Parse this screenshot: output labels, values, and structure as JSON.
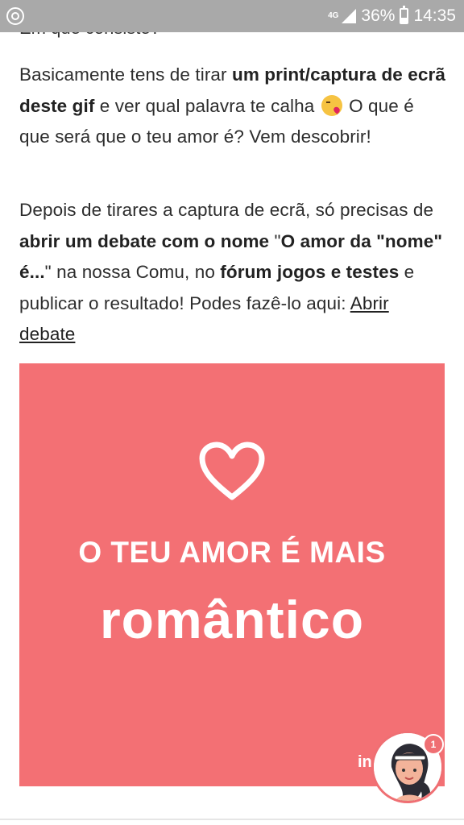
{
  "status_bar": {
    "network": "4G",
    "battery_percent": "36%",
    "time": "14:35",
    "icons": [
      "account-circle-icon",
      "signal-icon",
      "battery-icon"
    ]
  },
  "article": {
    "clipped_heading": "Em que consiste?",
    "p1": {
      "t1": "Basicamente tens de tirar ",
      "b1": "um print/captura de ecrã deste gif",
      "t2": " e ver qual palavra te calha ",
      "emoji": "face-blowing-kiss",
      "t3": " O que é que será que o teu amor é? Vem descobrir!"
    },
    "p2": {
      "t1": "Depois de tirares a captura de ecrã, só precisas de ",
      "b1": "abrir um debate com o nome",
      "t2": " \"",
      "b2": "O amor da \"nome\" é...",
      "t3": "\" na nossa Comu, no ",
      "b3": "fórum jogos e testes",
      "t4": " e publicar o resultado! Podes fazê-lo aqui: ",
      "link": "Abrir debate"
    }
  },
  "card": {
    "bg_color": "#f37074",
    "icon": "heart-outline-icon",
    "line1": "O TEU AMOR É MAIS",
    "line2": "romântico",
    "brand_partial": "in"
  },
  "floating_chat": {
    "badge_count": "1",
    "accent": "#ef6f73"
  }
}
